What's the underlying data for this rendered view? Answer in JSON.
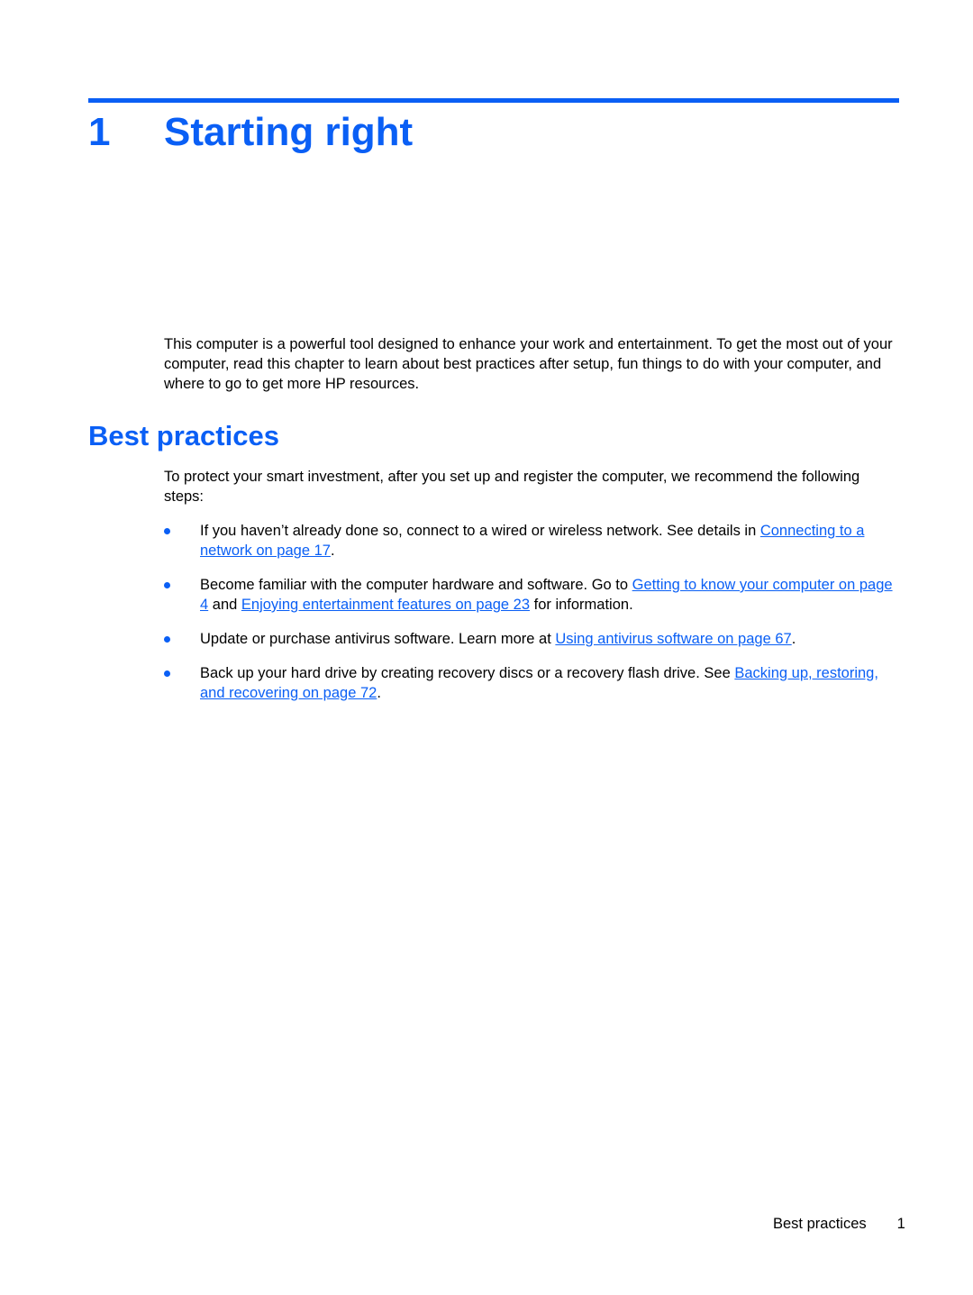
{
  "chapter": {
    "number": "1",
    "title": "Starting right"
  },
  "intro": "This computer is a powerful tool designed to enhance your work and entertainment. To get the most out of your computer, read this chapter to learn about best practices after setup, fun things to do with your computer, and where to go to get more HP resources.",
  "section": {
    "title": "Best practices",
    "lead": "To protect your smart investment, after you set up and register the computer, we recommend the following steps:",
    "bullets": [
      {
        "t1": "If you haven’t already done so, connect to a wired or wireless network. See details in ",
        "link1": "Connecting to a network on page 17",
        "t2": "."
      },
      {
        "t1": "Become familiar with the computer hardware and software. Go to ",
        "link1": "Getting to know your computer on page 4",
        "t2": " and ",
        "link2": "Enjoying entertainment features on page 23",
        "t3": " for information."
      },
      {
        "t1": "Update or purchase antivirus software. Learn more at ",
        "link1": "Using antivirus software on page 67",
        "t2": "."
      },
      {
        "t1": "Back up your hard drive by creating recovery discs or a recovery flash drive. See ",
        "link1": "Backing up, restoring, and recovering on page 72",
        "t2": "."
      }
    ]
  },
  "footer": {
    "section": "Best practices",
    "page": "1"
  }
}
